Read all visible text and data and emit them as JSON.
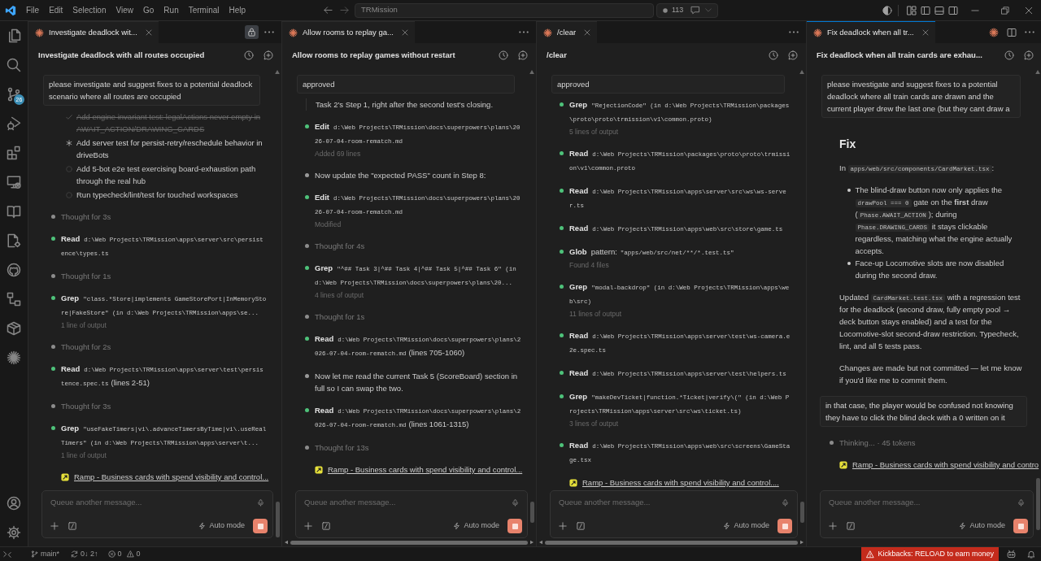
{
  "title_bar": {
    "menu": [
      "File",
      "Edit",
      "Selection",
      "View",
      "Go",
      "Run",
      "Terminal",
      "Help"
    ],
    "command_center": "TRMission",
    "count": "113"
  },
  "activity_bar": {
    "source_control_badge": "26"
  },
  "groups": [
    {
      "focused": false,
      "tab": {
        "label": "Investigate deadlock wit...",
        "selected": true
      },
      "tab_actions": [
        {
          "kind": "lock",
          "on": true
        },
        {
          "kind": "more",
          "on": false
        }
      ],
      "title": "Investigate deadlock with all routes occupied",
      "prompt": "please investigate and suggest fixes to a potential deadlock scenario where all routes are occupied",
      "feed": [
        {
          "kind": "todos",
          "items": [
            {
              "text": "Add engine invariant test: legalActions never empty in AWAIT_ACTION/DRAWING_CARDS",
              "checked": true,
              "active": false
            },
            {
              "text": "Add server test for persist-retry/reschedule behavior in driveBots",
              "checked": false,
              "active": true
            },
            {
              "text": "Add 5-bot e2e test exercising board-exhaustion path through the real hub",
              "checked": false,
              "active": false
            },
            {
              "text": "Run typecheck/lint/test for touched workspaces",
              "checked": false,
              "active": false
            }
          ]
        },
        {
          "kind": "thought",
          "text": "Thought for 3s",
          "color": "#8c8c8c"
        },
        {
          "kind": "tool",
          "name": "Read",
          "args": "d:\\Web Projects\\TRMission\\apps\\server\\src\\persistence\\types.ts",
          "color": "#4ec27a"
        },
        {
          "kind": "thought",
          "text": "Thought for 1s",
          "color": "#8c8c8c"
        },
        {
          "kind": "tool",
          "name": "Grep",
          "args": "\"class.*Store|implements GameStorePort|InMemoryStore|FakeStore\" (in d:\\Web Projects\\TRMission\\apps\\se...",
          "detail": "1 line of output",
          "color": "#4ec27a"
        },
        {
          "kind": "thought",
          "text": "Thought for 2s",
          "color": "#8c8c8c"
        },
        {
          "kind": "tool",
          "name": "Read",
          "args": "d:\\Web Projects\\TRMission\\apps\\server\\test\\persistence.spec.ts",
          "suffix": "(lines 2-51)",
          "color": "#4ec27a"
        },
        {
          "kind": "thought",
          "text": "Thought for 3s",
          "color": "#8c8c8c"
        },
        {
          "kind": "tool",
          "name": "Grep",
          "args": "\"useFakeTimers|vi\\.advanceTimersByTime|vi\\.useRealTimers\" (in d:\\Web Projects\\TRMission\\apps\\server\\t...",
          "detail": "1 line of output",
          "color": "#4ec27a"
        },
        {
          "kind": "link",
          "text": "Ramp - Business cards with spend visibility and control..."
        }
      ],
      "composer": {
        "placeholder": "Queue another message...",
        "mode": "Auto mode"
      }
    },
    {
      "focused": false,
      "tab": {
        "label": "Allow rooms to replay ga...",
        "selected": true
      },
      "tab_actions": [
        {
          "kind": "more",
          "on": false
        }
      ],
      "title": "Allow rooms to replay games without restart",
      "prompt": "approved",
      "feed": [
        {
          "kind": "continuation",
          "text": "Task 2's Step 1, right after the second test's closing."
        },
        {
          "kind": "tool",
          "name": "Edit",
          "args": "d:\\Web Projects\\TRMission\\docs\\superpowers\\plans\\2026-07-04-room-rematch.md",
          "detail": "Added 69 lines",
          "color": "#4ec27a"
        },
        {
          "kind": "message",
          "text": "Now update the \"expected PASS\" count in Step 8:",
          "color": "#9a9a9a"
        },
        {
          "kind": "tool",
          "name": "Edit",
          "args": "d:\\Web Projects\\TRMission\\docs\\superpowers\\plans\\2026-07-04-room-rematch.md",
          "detail": "Modified",
          "color": "#4ec27a"
        },
        {
          "kind": "thought",
          "text": "Thought for 4s",
          "color": "#8c8c8c"
        },
        {
          "kind": "tool",
          "name": "Grep",
          "args": "\"^## Task 3|^## Task 4|^## Task 5|^## Task 6\" (in d:\\Web Projects\\TRMission\\docs\\superpowers\\plans\\20...",
          "detail": "4 lines of output",
          "color": "#4ec27a"
        },
        {
          "kind": "thought",
          "text": "Thought for 1s",
          "color": "#8c8c8c"
        },
        {
          "kind": "tool",
          "name": "Read",
          "args": "d:\\Web Projects\\TRMission\\docs\\superpowers\\plans\\2026-07-04-room-rematch.md",
          "suffix": "(lines 705-1060)",
          "color": "#4ec27a"
        },
        {
          "kind": "message",
          "text": "Now let me read the current Task 5 (ScoreBoard) section in full so I can swap the two.",
          "color": "#9a9a9a"
        },
        {
          "kind": "tool",
          "name": "Read",
          "args": "d:\\Web Projects\\TRMission\\docs\\superpowers\\plans\\2026-07-04-room-rematch.md",
          "suffix": "(lines 1061-1315)",
          "color": "#4ec27a"
        },
        {
          "kind": "thought",
          "text": "Thought for 13s",
          "color": "#8c8c8c"
        },
        {
          "kind": "link",
          "text": "Ramp - Business cards with spend visibility and control..."
        }
      ],
      "composer": {
        "placeholder": "Queue another message...",
        "mode": "Auto mode"
      },
      "horizontal_scrollbar": true
    },
    {
      "focused": false,
      "tab": {
        "label": "/clear",
        "selected": true
      },
      "tab_actions": [
        {
          "kind": "more",
          "on": false
        }
      ],
      "title": "/clear",
      "prompt": "approved",
      "feed": [
        {
          "kind": "tool",
          "name": "Grep",
          "args": "\"RejectionCode\" (in d:\\Web Projects\\TRMission\\packages\\proto\\proto\\trmission\\v1\\common.proto)",
          "detail": "5 lines of output",
          "color": "#4ec27a"
        },
        {
          "kind": "tool",
          "name": "Read",
          "args": "d:\\Web Projects\\TRMission\\packages\\proto\\proto\\trmission\\v1\\common.proto",
          "color": "#4ec27a"
        },
        {
          "kind": "tool",
          "name": "Read",
          "args": "d:\\Web Projects\\TRMission\\apps\\server\\src\\ws\\ws-server.ts",
          "color": "#4ec27a"
        },
        {
          "kind": "tool",
          "name": "Read",
          "args": "d:\\Web Projects\\TRMission\\apps\\web\\src\\store\\game.ts",
          "color": "#4ec27a"
        },
        {
          "kind": "tool",
          "name": "Glob",
          "prefix": "pattern:",
          "args": "\"apps/web/src/net/**/*.test.ts\"",
          "detail": "Found 4 files",
          "color": "#4ec27a"
        },
        {
          "kind": "tool",
          "name": "Grep",
          "args": "\"modal-backdrop\" (in d:\\Web Projects\\TRMission\\apps\\web\\src)",
          "detail": "11 lines of output",
          "color": "#4ec27a"
        },
        {
          "kind": "tool",
          "name": "Read",
          "args": "d:\\Web Projects\\TRMission\\apps\\server\\test\\ws-camera.e2e.spec.ts",
          "color": "#4ec27a"
        },
        {
          "kind": "tool",
          "name": "Read",
          "args": "d:\\Web Projects\\TRMission\\apps\\server\\test\\helpers.ts",
          "color": "#4ec27a"
        },
        {
          "kind": "tool",
          "name": "Grep",
          "args": "\"makeDevTicket|function.*Ticket|verify\\(\" (in d:\\Web Projects\\TRMission\\apps\\server\\src\\ws\\ticket.ts)",
          "detail": "3 lines of output",
          "color": "#4ec27a"
        },
        {
          "kind": "tool",
          "name": "Read",
          "args": "d:\\Web Projects\\TRMission\\apps\\web\\src\\screens\\GameStage.tsx",
          "color": "#4ec27a"
        },
        {
          "kind": "link",
          "text": "Ramp - Business cards with spend visibility and control...."
        }
      ],
      "composer": {
        "placeholder": "Queue another message...",
        "mode": "Auto mode"
      },
      "horizontal_scrollbar": true
    },
    {
      "focused": true,
      "tab": {
        "label": "Fix deadlock when all tr...",
        "selected": true
      },
      "tab_actions": [
        {
          "kind": "starburst",
          "on": false
        },
        {
          "kind": "split",
          "on": false
        },
        {
          "kind": "more",
          "on": false
        }
      ],
      "title": "Fix deadlock when all train cards are exhau...",
      "prompt": "please investigate and suggest fixes to a potential deadlock where all train cards are drawn and the current player drew the last one (but they cant draw a",
      "feed": [
        {
          "kind": "heading",
          "text": "Fix"
        },
        {
          "kind": "paragraph",
          "parts": [
            {
              "kind": "text",
              "text": "In "
            },
            {
              "kind": "code",
              "text": "apps/web/src/components/CardMarket.tsx"
            },
            {
              "kind": "text",
              "text": ":"
            }
          ]
        },
        {
          "kind": "bullets",
          "items": [
            [
              {
                "kind": "text",
                "text": "The blind-draw button now only applies the "
              },
              {
                "kind": "code",
                "text": "drawPool === 0"
              },
              {
                "kind": "text",
                "text": " gate on the **first** draw ("
              },
              {
                "kind": "code",
                "text": "Phase.AWAIT_ACTION"
              },
              {
                "kind": "text",
                "text": "); during "
              },
              {
                "kind": "code",
                "text": "Phase.DRAWING_CARDS"
              },
              {
                "kind": "text",
                "text": " it stays clickable regardless, matching what the engine actually accepts."
              }
            ],
            [
              {
                "kind": "text",
                "text": "Face-up Locomotive slots are now disabled during the second draw."
              }
            ]
          ]
        },
        {
          "kind": "paragraph",
          "parts": [
            {
              "kind": "text",
              "text": "Updated "
            },
            {
              "kind": "code",
              "text": "CardMarket.test.tsx"
            },
            {
              "kind": "text",
              "text": " with a regression test for the deadlock (second draw, fully empty pool → deck button stays enabled) and a test for the Locomotive-slot second-draw restriction. Typecheck, lint, and all 5 tests pass."
            }
          ]
        },
        {
          "kind": "paragraph",
          "parts": [
            {
              "kind": "text",
              "text": "Changes are made but not committed — let me know if you'd like me to commit them."
            }
          ]
        },
        {
          "kind": "user_message",
          "text": "in that case, the player would be confused not knowing they have to click the blind deck with a 0 written on it"
        },
        {
          "kind": "thought",
          "text": "Thinking... · 45 tokens",
          "color": "#8c8c8c"
        },
        {
          "kind": "link",
          "text": "Ramp - Business cards with spend visibility and contro"
        }
      ],
      "composer": {
        "placeholder": "Queue another message...",
        "mode": "Auto mode"
      }
    }
  ],
  "status_bar": {
    "branch": "main*",
    "sync": "0↓ 2↑",
    "errors": "0",
    "warnings": "0",
    "notice": "Kickbacks: RELOAD to earn money"
  }
}
